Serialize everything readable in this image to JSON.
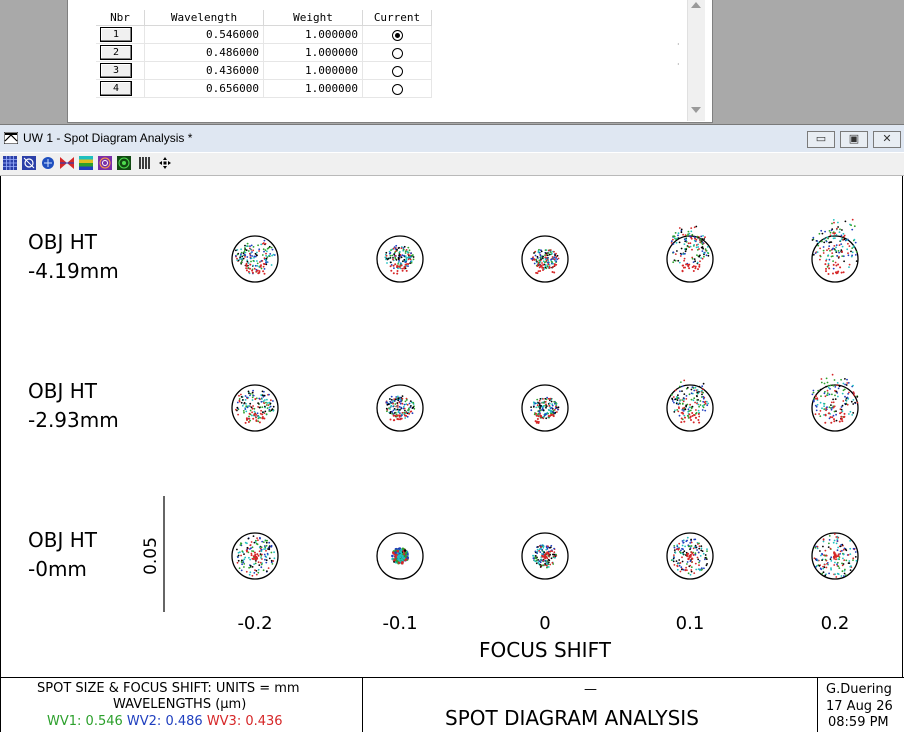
{
  "wavelength_table": {
    "headers": [
      "Nbr",
      "Wavelength",
      "Weight",
      "Current"
    ],
    "rows": [
      {
        "nbr": "1",
        "wavelength": "0.546000",
        "weight": "1.000000",
        "current": true
      },
      {
        "nbr": "2",
        "wavelength": "0.486000",
        "weight": "1.000000",
        "current": false
      },
      {
        "nbr": "3",
        "wavelength": "0.436000",
        "weight": "1.000000",
        "current": false
      },
      {
        "nbr": "4",
        "wavelength": "0.656000",
        "weight": "1.000000",
        "current": false
      }
    ]
  },
  "window": {
    "title": "UW 1 - Spot Diagram Analysis *",
    "minimize_glyph": "▭",
    "maximize_glyph": "▣",
    "close_glyph": "✕"
  },
  "toolbar": {
    "icons": [
      "grid-icon",
      "field-icon",
      "globe-icon",
      "bow-tie-icon",
      "color-bars-icon",
      "target-icon",
      "green-target-icon",
      "bar-chart-icon",
      "move-icon"
    ]
  },
  "spot_diagram": {
    "row_labels": [
      {
        "line1": "OBJ HT",
        "line2": "-4.19mm"
      },
      {
        "line1": "OBJ HT",
        "line2": "-2.93mm"
      },
      {
        "line1": "OBJ HT",
        "line2": "-0mm"
      }
    ],
    "scale_bar_label": "0.05",
    "focus_values": [
      "-0.2",
      "-0.1",
      "0",
      "0.1",
      "0.2"
    ],
    "axis_label": "FOCUS SHIFT"
  },
  "footer": {
    "line1": "SPOT SIZE & FOCUS SHIFT: UNITS = mm",
    "line2": "WAVELENGTHS (μm)",
    "wavelengths": [
      {
        "label": "WV1:",
        "value": "0.546",
        "color": "#2ca02c"
      },
      {
        "label": "WV2:",
        "value": "0.486",
        "color": "#1f3fbf"
      },
      {
        "label": "WV3:",
        "value": "0.436",
        "color": "#d62728"
      }
    ],
    "dash": "—",
    "title": "SPOT DIAGRAM ANALYSIS",
    "author": "G.Duering",
    "date": "17 Aug 26",
    "time": "08:59 PM"
  },
  "colors": {
    "title_bar": "#dfe7f2",
    "spot_red": "#d62728",
    "spot_blue": "#1f3fbf",
    "spot_cyan": "#1fbfbf",
    "spot_green": "#2ca02c"
  }
}
